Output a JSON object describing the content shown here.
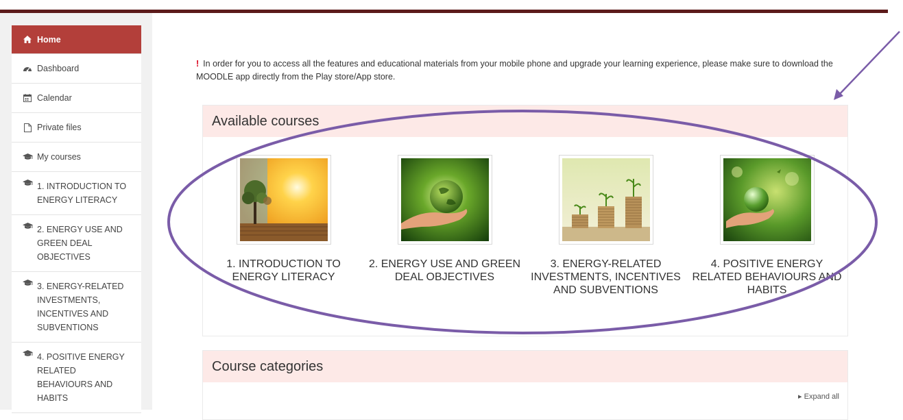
{
  "sidebar": {
    "items": [
      {
        "label": "Home",
        "icon": "home-icon",
        "active": true
      },
      {
        "label": "Dashboard",
        "icon": "dashboard-icon"
      },
      {
        "label": "Calendar",
        "icon": "calendar-icon"
      },
      {
        "label": "Private files",
        "icon": "file-icon"
      },
      {
        "label": "My courses",
        "icon": "graduation-cap-icon"
      },
      {
        "label": "1. INTRODUCTION TO ENERGY LITERACY",
        "icon": "graduation-cap-icon"
      },
      {
        "label": "2. ENERGY USE AND GREEN DEAL OBJECTIVES",
        "icon": "graduation-cap-icon"
      },
      {
        "label": "3. ENERGY-RELATED INVESTMENTS, INCENTIVES AND SUBVENTIONS",
        "icon": "graduation-cap-icon"
      },
      {
        "label": "4. POSITIVE ENERGY RELATED BEHAVIOURS AND HABITS",
        "icon": "graduation-cap-icon"
      }
    ]
  },
  "notice": {
    "text": "In order for you to access all the features and educational materials  from your mobile phone and upgrade your learning experience, please make sure to download the MOODLE app directly from the Play store/App store."
  },
  "available_courses": {
    "title": "Available courses",
    "courses": [
      {
        "title": "1. INTRODUCTION TO ENERGY LITERACY",
        "image": "tree-and-sunset-image"
      },
      {
        "title": "2. ENERGY USE AND GREEN DEAL OBJECTIVES",
        "image": "hand-holding-globe-image"
      },
      {
        "title": "3. ENERGY-RELATED INVESTMENTS, INCENTIVES AND SUBVENTIONS",
        "image": "coin-stacks-with-plants-image"
      },
      {
        "title": "4. POSITIVE ENERGY RELATED BEHAVIOURS AND HABITS",
        "image": "hand-holding-glass-globe-image"
      }
    ]
  },
  "course_categories": {
    "title": "Course categories",
    "expand_label": "Expand all"
  },
  "colors": {
    "accent": "#b33f3a",
    "header_bar": "#5c1a1a",
    "block_header": "#fde9e7",
    "annotation": "#7a5ca8"
  }
}
